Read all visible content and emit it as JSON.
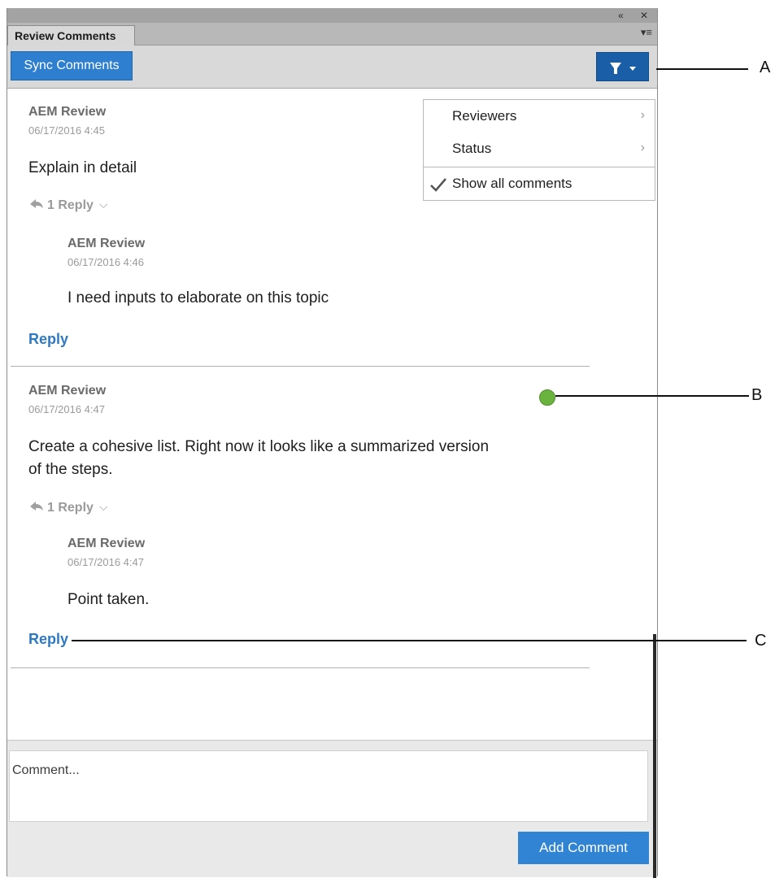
{
  "window": {
    "collapse_glyph": "«",
    "close_glyph": "✕",
    "menu_glyph": "▾≡"
  },
  "tab": {
    "title": "Review Comments"
  },
  "toolbar": {
    "sync_label": "Sync Comments",
    "filter_icon": "filter-icon",
    "dropdown_icon": "caret-down-icon"
  },
  "filter_menu": {
    "items": [
      {
        "label": "Reviewers",
        "submenu": true
      },
      {
        "label": "Status",
        "submenu": true
      },
      {
        "label": "Show all comments",
        "checked": true
      }
    ]
  },
  "comments": [
    {
      "author": "AEM Review",
      "date": "06/17/2016 4:45",
      "text": "Explain in detail",
      "reply_count_label": "1 Reply",
      "reply": {
        "author": "AEM Review",
        "date": "06/17/2016 4:46",
        "text": "I need inputs to elaborate on this topic"
      },
      "reply_link": "Reply"
    },
    {
      "author": "AEM Review",
      "date": "06/17/2016 4:47",
      "text_line1": "Create a cohesive list. Right now it looks like a summarized version",
      "text_line2": "of the steps.",
      "status_color": "#6ab33e",
      "reply_count_label": "1 Reply",
      "reply": {
        "author": "AEM Review",
        "date": "06/17/2016 4:47",
        "text": "Point taken."
      },
      "reply_link": "Reply"
    }
  ],
  "compose": {
    "placeholder": "Comment...",
    "add_label": "Add Comment"
  },
  "callouts": {
    "a": "A",
    "b": "B",
    "c": "C"
  },
  "colors": {
    "accent": "#2f7fd0",
    "link": "#2f79c2",
    "status_green": "#6ab33e"
  }
}
